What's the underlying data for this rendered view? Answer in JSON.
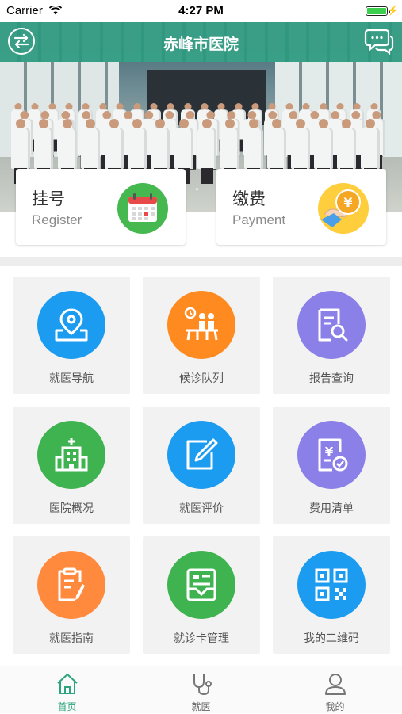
{
  "status_bar": {
    "carrier": "Carrier",
    "time": "4:27 PM"
  },
  "header": {
    "title": "赤峰市医院",
    "left_icon": "swap-arrows-icon",
    "right_icon": "chat-bubbles-icon"
  },
  "hero": {
    "page_indicator": "• • •"
  },
  "quick_actions": [
    {
      "cn": "挂号",
      "en": "Register",
      "icon": "calendar-icon",
      "color": "#45b94f"
    },
    {
      "cn": "缴费",
      "en": "Payment",
      "icon": "coin-payment-icon",
      "color": "#ffce3c"
    }
  ],
  "grid": [
    {
      "label": "就医导航",
      "icon": "map-pin-icon",
      "color": "#1b9cf0"
    },
    {
      "label": "候诊队列",
      "icon": "waiting-queue-icon",
      "color": "#ff8a1f"
    },
    {
      "label": "报告查询",
      "icon": "report-search-icon",
      "color": "#8b7fe8"
    },
    {
      "label": "医院概况",
      "icon": "hospital-building-icon",
      "color": "#3fb34f"
    },
    {
      "label": "就医评价",
      "icon": "edit-review-icon",
      "color": "#1b9cf0"
    },
    {
      "label": "费用清单",
      "icon": "bill-list-icon",
      "color": "#8b7fe8"
    },
    {
      "label": "就医指南",
      "icon": "guide-clipboard-icon",
      "color": "#ff8a3d"
    },
    {
      "label": "就诊卡管理",
      "icon": "medical-card-icon",
      "color": "#3fb34f"
    },
    {
      "label": "我的二维码",
      "icon": "qr-code-icon",
      "color": "#1b9cf0"
    }
  ],
  "tab_bar": [
    {
      "label": "首页",
      "icon": "home-icon",
      "active": true
    },
    {
      "label": "就医",
      "icon": "stethoscope-icon",
      "active": false
    },
    {
      "label": "我的",
      "icon": "user-icon",
      "active": false
    }
  ],
  "colors": {
    "accent": "#2aa57d",
    "header_bg": "#1f9679"
  }
}
